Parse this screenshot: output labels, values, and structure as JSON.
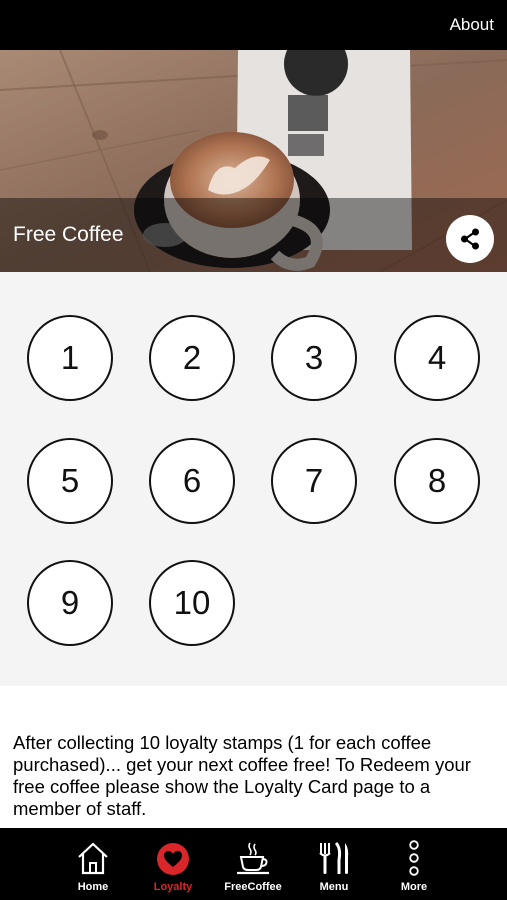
{
  "header": {
    "about_label": "About"
  },
  "hero": {
    "title": "Free Coffee"
  },
  "stamps": [
    "1",
    "2",
    "3",
    "4",
    "5",
    "6",
    "7",
    "8",
    "9",
    "10"
  ],
  "description": "After collecting 10 loyalty stamps (1 for each coffee purchased)... get your next coffee free! To Redeem your free coffee please show the Loyalty Card page to a member of staff.",
  "tabs": [
    {
      "label": "Home",
      "icon": "home-icon"
    },
    {
      "label": "Loyalty",
      "icon": "heart-icon",
      "active": true
    },
    {
      "label": "FreeCoffee",
      "icon": "coffee-cup-icon"
    },
    {
      "label": "Menu",
      "icon": "cutlery-icon"
    },
    {
      "label": "More",
      "icon": "more-dots-icon"
    }
  ],
  "colors": {
    "accent": "#d9262b",
    "bar_bg": "#000000",
    "stamp_area_bg": "#f4f4f4"
  }
}
